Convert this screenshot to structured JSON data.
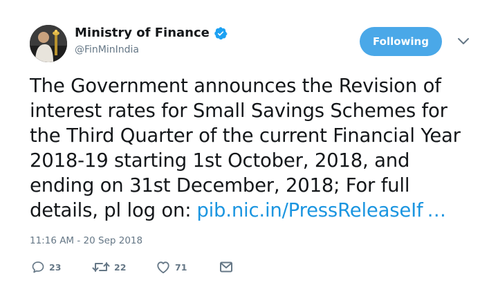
{
  "account": {
    "display_name": "Ministry of Finance",
    "handle": "@FinMinIndia",
    "verified": true
  },
  "follow_button": {
    "label": "Following"
  },
  "tweet": {
    "lines": [
      "The Government announces the Revision of",
      "interest rates for Small Savings Schemes for",
      "the Third Quarter of the current Financial Year",
      "2018-19 starting 1st October, 2018, and",
      "ending on 31st December, 2018; For full"
    ],
    "last_line_prefix": "details, pl log on:",
    "link_text": "pib.nic.in/PressReleaseIf",
    "ellipsis": "…",
    "timestamp": "11:16 AM - 20 Sep 2018"
  },
  "actions": {
    "replies": "23",
    "retweets": "22",
    "likes": "71"
  },
  "colors": {
    "accent": "#1b95e0",
    "follow_bg": "#4aa8e8",
    "muted": "#657786",
    "text": "#14171a"
  },
  "icons": [
    "verified-badge-icon",
    "chevron-down-icon",
    "reply-icon",
    "retweet-icon",
    "like-icon",
    "direct-message-icon"
  ]
}
